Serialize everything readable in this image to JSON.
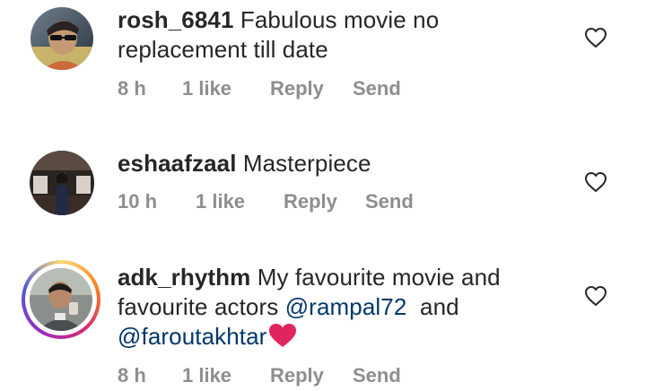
{
  "comments": [
    {
      "username": "rosh_6841",
      "text": "Fabulous movie no replacement till date",
      "time": "8 h",
      "likes": "1 like",
      "reply_label": "Reply",
      "send_label": "Send",
      "has_story_ring": false
    },
    {
      "username": "eshaafzaal",
      "text": "Masterpiece",
      "time": "10 h",
      "likes": "1 like",
      "reply_label": "Reply",
      "send_label": "Send",
      "has_story_ring": false
    },
    {
      "username": "adk_rhythm",
      "text_part1": "My favourite movie and favourite actors",
      "mention1": "@rampal72",
      "text_part2": "and",
      "mention2": "@faroutakhtar",
      "emoji_icon": "red-heart-emoji",
      "time": "8 h",
      "likes": "1 like",
      "reply_label": "Reply",
      "send_label": "Send",
      "has_story_ring": true
    }
  ],
  "colors": {
    "text": "#262626",
    "meta": "#8e8e8e",
    "mention": "#00376b",
    "heart_emoji": "#e0245e"
  },
  "icons": {
    "like": "heart-outline-icon"
  }
}
